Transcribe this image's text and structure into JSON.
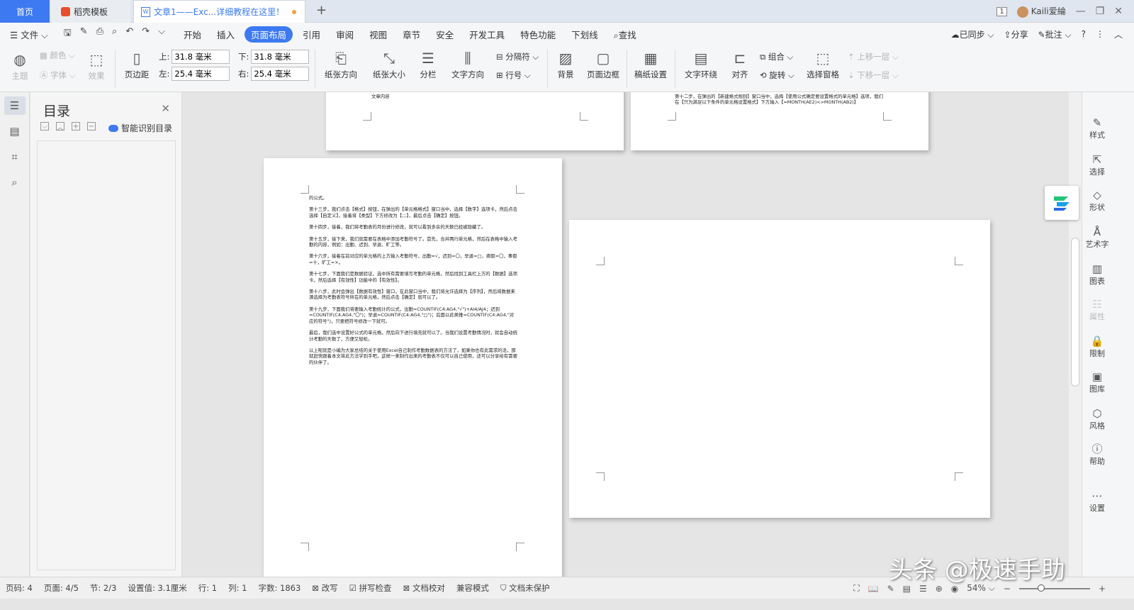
{
  "titlebar": {
    "tabs": [
      "首页",
      "稻壳模板",
      "文章1——Exc...详细教程在这里！"
    ],
    "badge": "1",
    "user": "Kaili爱綸"
  },
  "menu": {
    "file": "文件",
    "items": [
      "开始",
      "插入",
      "页面布局",
      "引用",
      "审阅",
      "视图",
      "章节",
      "安全",
      "开发工具",
      "特色功能",
      "下划线"
    ],
    "search": "查找",
    "synced": "已同步",
    "share": "分享",
    "comment": "批注",
    "help": "?"
  },
  "ribbon": {
    "theme": "主题",
    "colors": "颜色",
    "font": "字体",
    "effects": "效果",
    "margins": "页边距",
    "top_label": "上:",
    "top_value": "31.8 毫米",
    "bottom_label": "下:",
    "bottom_value": "31.8 毫米",
    "left_label": "左:",
    "left_value": "25.4 毫米",
    "right_label": "右:",
    "right_value": "25.4 毫米",
    "orientation": "纸张方向",
    "size": "纸张大小",
    "columns": "分栏",
    "text_direction": "文字方向",
    "separator": "分隔符",
    "line_numbers": "行号",
    "background": "背景",
    "page_border": "页面边框",
    "paper_settings": "稿纸设置",
    "wrap": "文字环绕",
    "align": "对齐",
    "group": "组合",
    "rotate": "旋转",
    "select_pane": "选择窗格",
    "bring_forward": "上移一层",
    "send_backward": "下移一层"
  },
  "toc": {
    "title": "目录",
    "smart": "智能识别目录"
  },
  "pages": {
    "p1_text": "文章内容",
    "p2_text": "第十二步，在弹出的【新建格式规则】窗口当中，选择【使用公式确定要设置格式的单元格】选项，我们在【只为满足以下条件的单元格设置格式】下方输入【=MONTH(AE2)<>MONTH(AB2)】",
    "p3_paragraphs": [
      "的公式。",
      "第十三步，我们点击【格式】按钮，在弹出的【单元格格式】窗口当中，选择【数字】选项卡，然后点击选择【自定义】，接着将【类型】下方修改为【;;;】，最后点击【确定】按钮。",
      "第十四步，接着，我们将考勤表的月份进行修改，就可以看到多余的天数已经被隐藏了。",
      "第十五步，接下来，我们就需要在表格中添加考勤符号了。首先，合并两行单元格，然后在表格中输入考勤的内容，例如：出勤、迟到、早退、旷工等。",
      "第十六步，接着在前对应的单元格的上方输入考勤符号，出勤=√，迟到=〇，早退=□，病假=〇，事假=十，旷工=×。",
      "第十七步，下面我们是数据验证，选中所有需要填写考勤的单元格，然后找到工具栏上方的【数据】选项卡，然后选择【有效性】功能中的【有效性】。",
      "第十八步，此时会弹出【数据有效性】窗口，在此窗口当中，我们将允许选择为【序列】，然后将数据来源选择为考勤表符号所在的单元格，然后点击【确定】就可以了。",
      "第十九步，下面我们将要输入考勤统计的公式，出勤=COUNTIF(C4:AG4,\"√\")+AI4/AJ4；迟到=COUNTIF(C4:AG4,\"〇\")；早退=COUNTIF(C4:AG4,\"□\")；后面以此类推=COUNTIF(C4:AG4,\"对应的符号\")，只要把符号修改一下就可。",
      "最后，我们选中设置好公式的单元格，然后向下进行填充就可以了。当我们设置考勤情况时，就会自动统计考勤的天数了，方便又轻松。",
      "以上呢就是小编为大家总结的关于使用Excel自己制作考勤数据表的方法了，如果你也有此需求的话，那就赶快跟着本文将此方法学到手吧，这样一来制作出来的考勤表不仅可以自己使用，还可以分享给有需要的伙伴了。"
    ]
  },
  "rightpanel": [
    "样式",
    "选择",
    "形状",
    "艺术字",
    "图表",
    "属性",
    "限制",
    "图库",
    "风格",
    "帮助",
    "设置"
  ],
  "status": {
    "page_code": "页码: 4",
    "page": "页面: 4/5",
    "section": "节: 2/3",
    "setting": "设置值: 3.1厘米",
    "row": "行: 1",
    "col": "列: 1",
    "words": "字数: 1863",
    "revise": "改写",
    "spell": "拼写检查",
    "proof": "文档校对",
    "compat": "兼容模式",
    "protect": "文档未保护",
    "zoom": "54%"
  },
  "watermark": "头条 @极速手助",
  "colors": {
    "accent": "#3d7af2"
  }
}
